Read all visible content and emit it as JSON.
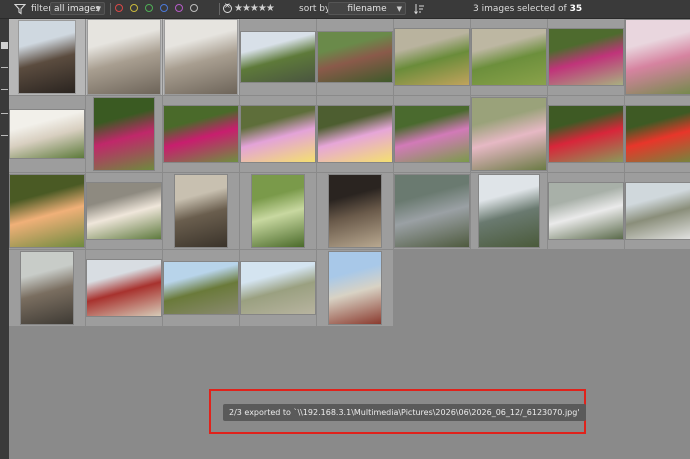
{
  "toolbar": {
    "filter_label": "filter",
    "filter_value": "all images",
    "color_labels": [
      {
        "name": "red",
        "color": "#d94848"
      },
      {
        "name": "yellow",
        "color": "#c8b83c"
      },
      {
        "name": "green",
        "color": "#4fae56"
      },
      {
        "name": "blue",
        "color": "#4b79d8"
      },
      {
        "name": "purple",
        "color": "#b55bc7"
      },
      {
        "name": "gray",
        "color": "#bdbdbd"
      }
    ],
    "rating_stars": "★★★★★",
    "sort_label": "sort by",
    "sort_value": "filename",
    "selection_prefix": "3 images selected of",
    "selection_total": "35"
  },
  "thumbnails": [
    {
      "id": "img-01",
      "palette": [
        "#cfd8e0",
        "#5b4c3f",
        "#2a2420"
      ],
      "selected": true
    },
    {
      "id": "img-02",
      "palette": [
        "#e6e4df",
        "#a89e90",
        "#6d6459"
      ],
      "selected": true
    },
    {
      "id": "img-03",
      "palette": [
        "#e6e4df",
        "#a89e90",
        "#6d6459"
      ],
      "selected": true
    },
    {
      "id": "img-04",
      "palette": [
        "#d8e0e8",
        "#5e7a3a",
        "#4a5540"
      ],
      "selected": false
    },
    {
      "id": "img-05",
      "palette": [
        "#6a8a4a",
        "#8a5a4a",
        "#3e5a2a"
      ],
      "selected": false
    },
    {
      "id": "img-06",
      "palette": [
        "#b9b39e",
        "#6a8c3a",
        "#c1a35d"
      ],
      "selected": false
    },
    {
      "id": "img-07",
      "palette": [
        "#bdb7a2",
        "#6c8f3c",
        "#8aa24a"
      ],
      "selected": false
    },
    {
      "id": "img-08",
      "palette": [
        "#4e6b2e",
        "#c0347a",
        "#a8b080"
      ],
      "selected": false
    },
    {
      "id": "img-09",
      "palette": [
        "#e9d6de",
        "#d683a0",
        "#6f8a48"
      ],
      "selected": false
    },
    {
      "id": "img-10",
      "palette": [
        "#f2f0ea",
        "#d8cfc0",
        "#5c7a3a"
      ],
      "selected": false
    },
    {
      "id": "img-11",
      "palette": [
        "#3a5a22",
        "#c0286a",
        "#6e8a3e"
      ],
      "selected": false
    },
    {
      "id": "img-12",
      "palette": [
        "#4a6a2a",
        "#c81e6e",
        "#6e9040"
      ],
      "selected": false
    },
    {
      "id": "img-13",
      "palette": [
        "#5e6e3a",
        "#e3a3d8",
        "#f4e070"
      ],
      "selected": false
    },
    {
      "id": "img-14",
      "palette": [
        "#4d5e30",
        "#e6a6d8",
        "#f4e070"
      ],
      "selected": false
    },
    {
      "id": "img-15",
      "palette": [
        "#4a6a2e",
        "#d27ab8",
        "#7a9a4a"
      ],
      "selected": false
    },
    {
      "id": "img-16",
      "palette": [
        "#9aa27a",
        "#e6b8c4",
        "#6a7a44"
      ],
      "selected": false
    },
    {
      "id": "img-17",
      "palette": [
        "#3e5a24",
        "#d8263a",
        "#8a9a5a"
      ],
      "selected": false
    },
    {
      "id": "img-18",
      "palette": [
        "#3e5a24",
        "#e8362a",
        "#6e8a3e"
      ],
      "selected": false
    },
    {
      "id": "img-19",
      "palette": [
        "#4a5a24",
        "#f0b078",
        "#6e8a3e"
      ],
      "selected": false
    },
    {
      "id": "img-20",
      "palette": [
        "#8e8a80",
        "#efe6da",
        "#5e7a3e"
      ],
      "selected": false
    },
    {
      "id": "img-21",
      "palette": [
        "#c8c0b0",
        "#6a5e4e",
        "#3a332a"
      ],
      "selected": false
    },
    {
      "id": "img-22",
      "palette": [
        "#7a9a4a",
        "#c8d8a0",
        "#4a6a2a"
      ],
      "selected": false
    },
    {
      "id": "img-23",
      "palette": [
        "#2a2420",
        "#6a5a4a",
        "#b8a890"
      ],
      "selected": false
    },
    {
      "id": "img-24",
      "palette": [
        "#6a7a70",
        "#9aa0a4",
        "#4e5a3e"
      ],
      "selected": false
    },
    {
      "id": "img-25",
      "palette": [
        "#dfe4e8",
        "#6a7a70",
        "#4a5a3a"
      ],
      "selected": false
    },
    {
      "id": "img-26",
      "palette": [
        "#a8b0a8",
        "#eaeaea",
        "#5a6a4a"
      ],
      "selected": false
    },
    {
      "id": "img-27",
      "palette": [
        "#d0d8dc",
        "#8a8e7a",
        "#e8e8e8"
      ],
      "selected": false
    },
    {
      "id": "img-28",
      "palette": [
        "#c8ccc8",
        "#7a6e60",
        "#3e3a34"
      ],
      "selected": false
    },
    {
      "id": "img-29",
      "palette": [
        "#d8dde2",
        "#a8322e",
        "#d6cbb8"
      ],
      "selected": false
    },
    {
      "id": "img-30",
      "palette": [
        "#b8d4ea",
        "#6a7a3a",
        "#8a8a70"
      ],
      "selected": false
    },
    {
      "id": "img-31",
      "palette": [
        "#d4e4f0",
        "#9aa080",
        "#b8b4a0"
      ],
      "selected": false
    },
    {
      "id": "img-32",
      "palette": [
        "#a8c8e8",
        "#d8d2c4",
        "#8a3a2e"
      ],
      "selected": false
    }
  ],
  "toast": {
    "message": "2/3 exported to `\\\\192.168.3.1\\Multimedia\\Pictures\\2026\\06\\2026_06_12/_6123070.jpg'"
  },
  "colors": {
    "background": "#8a8a8a",
    "toolbar": "#3a3a3a",
    "cell": "#9d9d9d",
    "cell_selected": "#b7b7b7",
    "highlight_box": "#e0221b"
  }
}
